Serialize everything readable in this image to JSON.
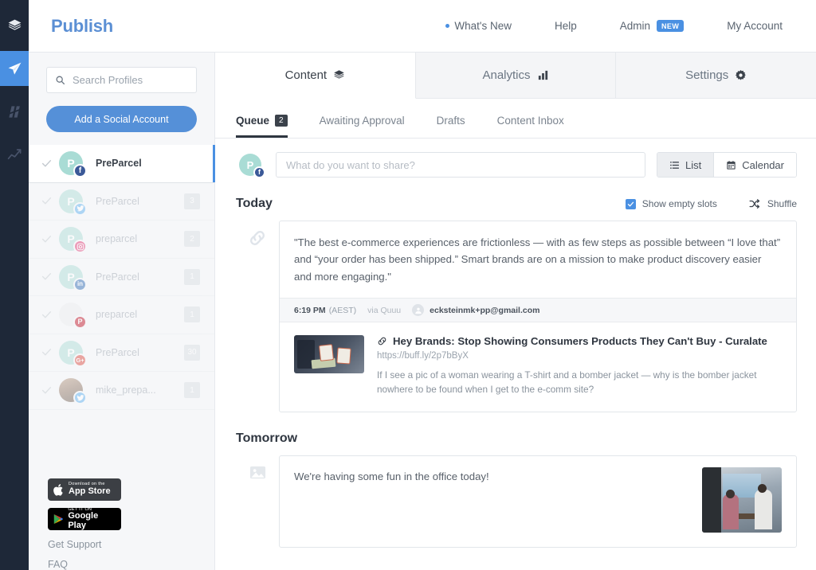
{
  "rail": {
    "items": [
      {
        "name": "layers-icon",
        "label": "Layers",
        "active": false
      },
      {
        "name": "publish-icon",
        "label": "Publish",
        "active": true
      },
      {
        "name": "reply-icon",
        "label": "Reply",
        "active": false
      },
      {
        "name": "analyze-icon",
        "label": "Analyze",
        "active": false
      }
    ]
  },
  "header": {
    "brand": "Publish",
    "nav": [
      {
        "label": "What's New",
        "dot": true,
        "badge": ""
      },
      {
        "label": "Help",
        "dot": false,
        "badge": ""
      },
      {
        "label": "Admin",
        "dot": false,
        "badge": "NEW"
      },
      {
        "label": "My Account",
        "dot": false,
        "badge": ""
      }
    ]
  },
  "sidebar": {
    "search_placeholder": "Search Profiles",
    "add_account_label": "Add a Social Account",
    "profiles": [
      {
        "name": "PreParcel",
        "network": "facebook",
        "glyph": "f",
        "color": "#3b5998",
        "count": "",
        "selected": true,
        "avatar": "letter",
        "initial": "P"
      },
      {
        "name": "PreParcel",
        "network": "twitter",
        "glyph": "t",
        "color": "#55acee",
        "count": "3",
        "selected": false,
        "avatar": "letter",
        "initial": "P"
      },
      {
        "name": "preparcel",
        "network": "instagram",
        "glyph": "o",
        "color": "#e1306c",
        "count": "2",
        "selected": false,
        "avatar": "letter",
        "initial": "P"
      },
      {
        "name": "PreParcel",
        "network": "linkedin",
        "glyph": "in",
        "color": "#2867b2",
        "count": "1",
        "selected": false,
        "avatar": "letter",
        "initial": "P"
      },
      {
        "name": "preparcel",
        "network": "pinterest",
        "glyph": "P",
        "color": "#bd081c",
        "count": "1",
        "selected": false,
        "avatar": "blank",
        "initial": ""
      },
      {
        "name": "PreParcel",
        "network": "googleplus",
        "glyph": "G+",
        "color": "#db4437",
        "count": "30",
        "selected": false,
        "avatar": "letter",
        "initial": "P"
      },
      {
        "name": "mike_prepa...",
        "network": "twitter",
        "glyph": "t",
        "color": "#55acee",
        "count": "1",
        "selected": false,
        "avatar": "photo",
        "initial": ""
      }
    ],
    "store_badges": [
      {
        "name": "app-store-badge",
        "small": "Download on the",
        "big": "App Store"
      },
      {
        "name": "google-play-badge",
        "small": "GET IT ON",
        "big": "Google Play"
      }
    ],
    "footer_links": [
      "Get Support",
      "FAQ"
    ]
  },
  "main": {
    "tabs": [
      {
        "label": "Content",
        "icon": "layers-icon",
        "active": true
      },
      {
        "label": "Analytics",
        "icon": "bars-icon",
        "active": false
      },
      {
        "label": "Settings",
        "icon": "gear-icon",
        "active": false
      }
    ],
    "subtabs": [
      {
        "label": "Queue",
        "badge": "2",
        "active": true
      },
      {
        "label": "Awaiting Approval",
        "badge": "",
        "active": false
      },
      {
        "label": "Drafts",
        "badge": "",
        "active": false
      },
      {
        "label": "Content Inbox",
        "badge": "",
        "active": false
      }
    ],
    "composer": {
      "placeholder": "What do you want to share?",
      "views": [
        {
          "label": "List",
          "icon": "list-icon",
          "active": true
        },
        {
          "label": "Calendar",
          "icon": "calendar-icon",
          "active": false
        }
      ]
    },
    "today": {
      "title": "Today",
      "show_empty_slots_label": "Show empty slots",
      "show_empty_slots_checked": true,
      "shuffle_label": "Shuffle",
      "post": {
        "gutter_icon": "link-icon",
        "text": "\"The best e-commerce experiences are frictionless — with as few steps as possible between “I love that” and “your order has been shipped.” Smart brands are on a mission to make product discovery easier and more engaging.\"",
        "time": "6:19 PM",
        "timezone": "(AEST)",
        "via": "via Quuu",
        "account": "ecksteinmk+pp@gmail.com",
        "link_title": "Hey Brands: Stop Showing Consumers Products They Can't Buy - Curalate",
        "link_url": "https://buff.ly/2p7bByX",
        "link_desc": "If I see a pic of a woman wearing a T-shirt and a bomber jacket — why is the bomber jacket nowhere to be found when I get to the e-comm site?"
      }
    },
    "tomorrow": {
      "title": "Tomorrow",
      "post": {
        "gutter_icon": "image-icon",
        "text": "We're having some fun in the office today!"
      }
    }
  },
  "colors": {
    "accent_blue": "#4a90e2",
    "brand_blue": "#5b8fd4",
    "rail_dark": "#1e2838",
    "sidebar_bg": "#f6f7f9",
    "avatar_teal": "#a9dcd5"
  }
}
